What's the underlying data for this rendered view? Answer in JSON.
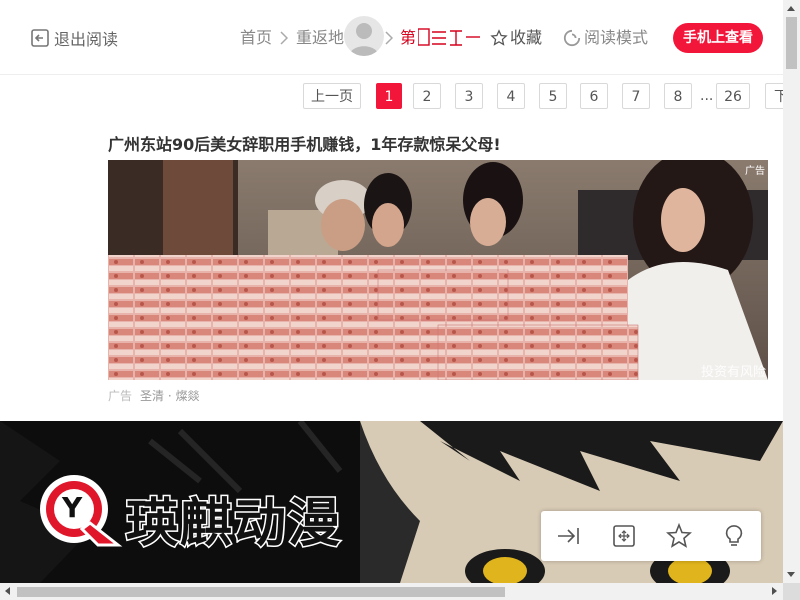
{
  "header": {
    "exit_label": "退出阅读",
    "breadcrumb_home": "首页",
    "breadcrumb_return": "重返地",
    "chapter_label": "第",
    "favorite_label": "收藏",
    "read_mode_label": "阅读模式",
    "phone_button": "手机上查看"
  },
  "pagination": {
    "prev": "上一页",
    "pages": [
      "1",
      "2",
      "3",
      "4",
      "5",
      "6",
      "7",
      "8"
    ],
    "active": "1",
    "ellipsis": "...",
    "last": "26",
    "next": "下"
  },
  "ad": {
    "title": "广州东站90后美女辞职用手机赚钱，1年存款惊呆父母!",
    "tag": "广告",
    "watermark": "投资有风险",
    "meta_label": "广告",
    "meta_source": "圣清 · 燦燚"
  },
  "comic": {
    "logo_text": "瑛麒动漫",
    "logo_mark": "Y"
  },
  "colors": {
    "accent": "#f2173a",
    "chapter": "#d6001c"
  }
}
